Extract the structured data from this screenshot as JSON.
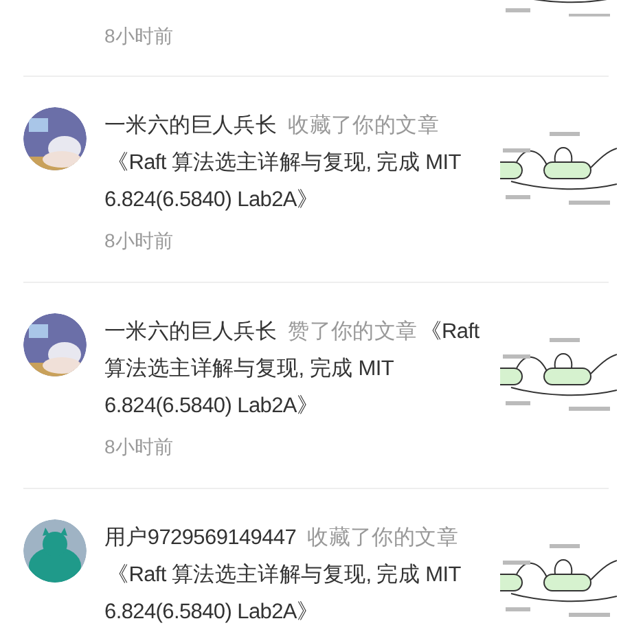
{
  "notifications": [
    {
      "time": "8小时前"
    },
    {
      "user": "一米六的巨人兵长",
      "action": "收藏了你的文章",
      "title": "《Raft 算法选主详解与复现, 完成 MIT 6.824(6.5840) Lab2A》",
      "time": "8小时前"
    },
    {
      "user": "一米六的巨人兵长",
      "action": "赞了你的文章",
      "title": "《Raft 算法选主详解与复现, 完成 MIT 6.824(6.5840) Lab2A》",
      "time": "8小时前"
    },
    {
      "user": "用户9729569149447",
      "action": "收藏了你的文章",
      "title": "《Raft 算法选主详解与复现, 完成 MIT 6.824(6.5840) Lab2A》"
    }
  ]
}
